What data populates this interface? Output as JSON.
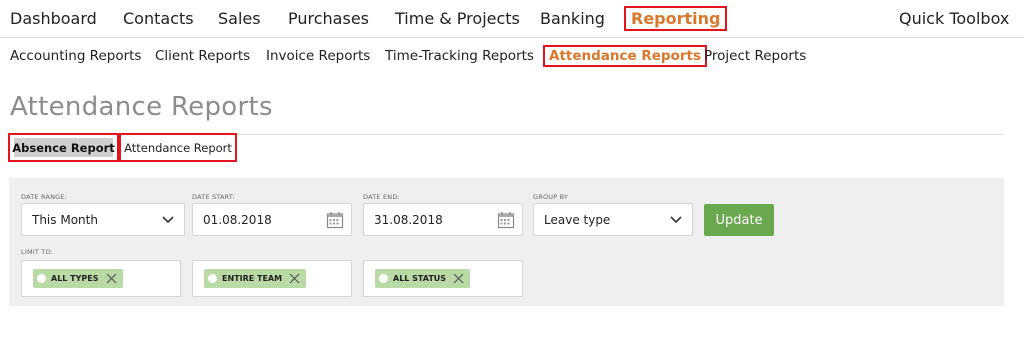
{
  "topnav": {
    "items": [
      "Dashboard",
      "Contacts",
      "Sales",
      "Purchases",
      "Time & Projects",
      "Banking",
      "Reporting"
    ],
    "active": "Reporting",
    "right": "Quick Toolbox"
  },
  "subnav": {
    "items": [
      "Accounting Reports",
      "Client Reports",
      "Invoice Reports",
      "Time-Tracking Reports",
      "Attendance Reports",
      "Project Reports"
    ],
    "active": "Attendance Reports"
  },
  "page_title": "Attendance Reports",
  "tabs": [
    "Absence Report",
    "Attendance Report"
  ],
  "filters": {
    "date_range": {
      "label": "DATE RANGE:",
      "value": "This Month"
    },
    "date_start": {
      "label": "DATE START:",
      "value": "01.08.2018"
    },
    "date_end": {
      "label": "DATE END:",
      "value": "31.08.2018"
    },
    "group_by": {
      "label": "GROUP BY",
      "value": "Leave type"
    },
    "update_label": "Update",
    "limit_label": "LIMIT TO:",
    "limit_tags": [
      "ALL TYPES",
      "ENTIRE TEAM",
      "ALL STATUS"
    ]
  },
  "colors": {
    "accent": "#d9772a",
    "highlight_border": "#e3141b",
    "button_green": "#6aa84f",
    "tag_green": "#b9d9a5",
    "panel_bg": "#efefef"
  }
}
